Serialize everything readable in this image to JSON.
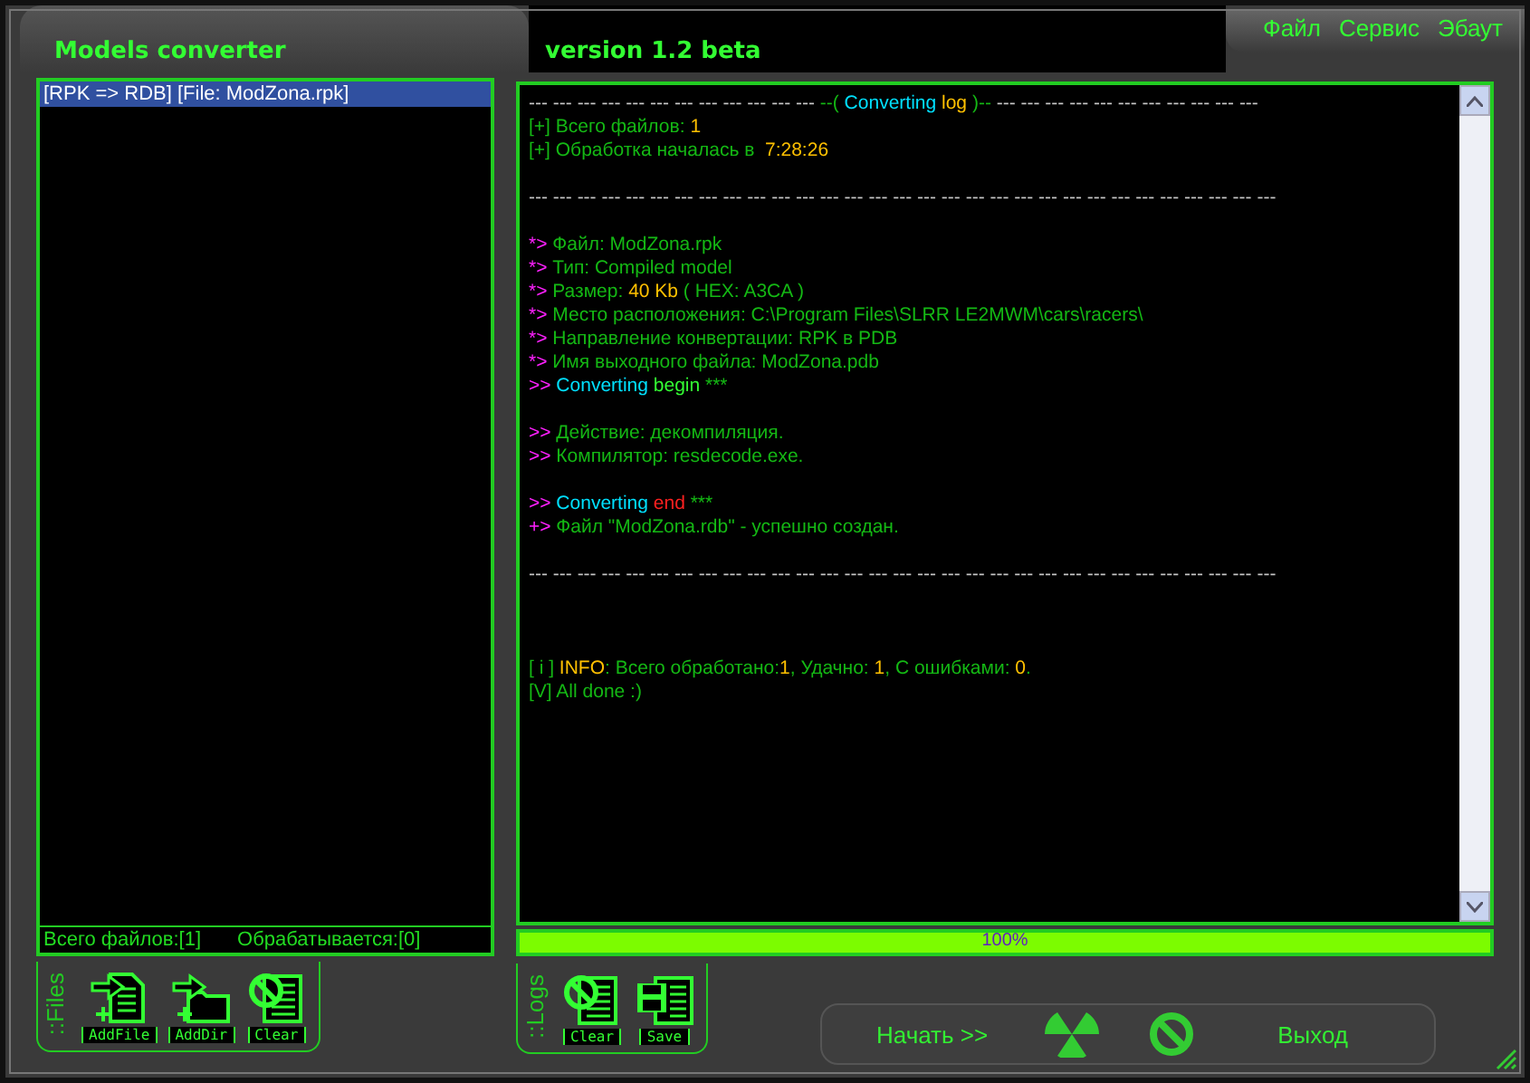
{
  "window": {
    "title": "Models converter",
    "version": "version 1.2 beta"
  },
  "menu": [
    {
      "label": "Файл"
    },
    {
      "label": "Сервис"
    },
    {
      "label": "Эбаут"
    }
  ],
  "files": {
    "items": [
      {
        "label": "[RPK => RDB] [File: ModZona.rpk]",
        "selected": true
      }
    ],
    "status": [
      "Всего файлов:[1]",
      "Обрабатывается:[0]"
    ],
    "toolbar_label": "::Files",
    "tools": [
      {
        "kind": "add_file",
        "label": "AddFile"
      },
      {
        "kind": "add_dir",
        "label": "AddDir"
      },
      {
        "kind": "clear",
        "label": "Clear"
      }
    ]
  },
  "log": {
    "lines": [
      {
        "kind": "text",
        "segments": [
          {
            "kind": "rule",
            "text": "--- --- --- --- --- --- --- --- --- --- --- --- "
          },
          {
            "kind": "text",
            "text": "--("
          },
          {
            "kind": "accent",
            "text": " Converting"
          },
          {
            "kind": "value",
            "text": " log"
          },
          {
            "kind": "text",
            "text": " )--"
          },
          {
            "kind": "rule",
            "text": " --- --- --- --- --- --- --- --- --- --- ---"
          }
        ]
      },
      {
        "kind": "text",
        "segments": [
          {
            "kind": "text",
            "text": "[+] Всего файлов: "
          },
          {
            "kind": "value",
            "text": "1"
          }
        ]
      },
      {
        "kind": "text",
        "segments": [
          {
            "kind": "text",
            "text": "[+] Обработка началась в  "
          },
          {
            "kind": "value",
            "text": "7:28:26"
          }
        ]
      },
      {
        "kind": "blank"
      },
      {
        "kind": "text",
        "segments": [
          {
            "kind": "rule",
            "text": "--- --- --- --- --- --- --- --- --- --- --- --- --- --- --- --- --- --- --- --- --- --- --- --- --- --- --- --- --- --- ---"
          }
        ]
      },
      {
        "kind": "blank"
      },
      {
        "kind": "text",
        "segments": [
          {
            "kind": "mark",
            "text": "*>"
          },
          {
            "kind": "text",
            "text": " Файл: ModZona.rpk"
          }
        ]
      },
      {
        "kind": "text",
        "segments": [
          {
            "kind": "mark",
            "text": "*>"
          },
          {
            "kind": "text",
            "text": " Тип: Compiled model"
          }
        ]
      },
      {
        "kind": "text",
        "segments": [
          {
            "kind": "mark",
            "text": "*>"
          },
          {
            "kind": "text",
            "text": " Размер: "
          },
          {
            "kind": "value",
            "text": "40 Kb"
          },
          {
            "kind": "text",
            "text": " ( HEX: A3CA )"
          }
        ]
      },
      {
        "kind": "text",
        "segments": [
          {
            "kind": "mark",
            "text": "*>"
          },
          {
            "kind": "text",
            "text": " Место расположения: C:\\Program Files\\SLRR LE2MWM\\cars\\racers\\"
          }
        ]
      },
      {
        "kind": "text",
        "segments": [
          {
            "kind": "mark",
            "text": "*>"
          },
          {
            "kind": "text",
            "text": " Направление конвертации: RPK в PDB"
          }
        ]
      },
      {
        "kind": "text",
        "segments": [
          {
            "kind": "mark",
            "text": "*>"
          },
          {
            "kind": "text",
            "text": " Имя выходного файла: ModZona.pdb"
          }
        ]
      },
      {
        "kind": "text",
        "segments": [
          {
            "kind": "mark",
            "text": ">>"
          },
          {
            "kind": "accent",
            "text": " Converting"
          },
          {
            "kind": "good",
            "text": " begin"
          },
          {
            "kind": "text",
            "text": " ***"
          }
        ]
      },
      {
        "kind": "blank"
      },
      {
        "kind": "text",
        "segments": [
          {
            "kind": "mark",
            "text": ">>"
          },
          {
            "kind": "text",
            "text": " Действие: декомпиляция."
          }
        ]
      },
      {
        "kind": "text",
        "segments": [
          {
            "kind": "mark",
            "text": ">>"
          },
          {
            "kind": "text",
            "text": " Компилятор: resdecode.exe."
          }
        ]
      },
      {
        "kind": "blank"
      },
      {
        "kind": "text",
        "segments": [
          {
            "kind": "mark",
            "text": ">>"
          },
          {
            "kind": "accent",
            "text": " Converting"
          },
          {
            "kind": "error",
            "text": " end"
          },
          {
            "kind": "text",
            "text": " ***"
          }
        ]
      },
      {
        "kind": "text",
        "segments": [
          {
            "kind": "mark",
            "text": "+>"
          },
          {
            "kind": "text",
            "text": " Файл \"ModZona.rdb\" - успешно создан."
          }
        ]
      },
      {
        "kind": "blank"
      },
      {
        "kind": "text",
        "segments": [
          {
            "kind": "rule",
            "text": "--- --- --- --- --- --- --- --- --- --- --- --- --- --- --- --- --- --- --- --- --- --- --- --- --- --- --- --- --- --- ---"
          }
        ]
      },
      {
        "kind": "blank"
      },
      {
        "kind": "blank"
      },
      {
        "kind": "blank"
      },
      {
        "kind": "text",
        "segments": [
          {
            "kind": "text",
            "text": "[ i ] "
          },
          {
            "kind": "value",
            "text": "INFO"
          },
          {
            "kind": "text",
            "text": ": Всего обработано:"
          },
          {
            "kind": "value",
            "text": "1"
          },
          {
            "kind": "text",
            "text": ", Удачно: "
          },
          {
            "kind": "value",
            "text": "1"
          },
          {
            "kind": "text",
            "text": ", С ошибками: "
          },
          {
            "kind": "value",
            "text": "0"
          },
          {
            "kind": "text",
            "text": "."
          }
        ]
      },
      {
        "kind": "text",
        "segments": [
          {
            "kind": "text",
            "text": "[V] All done :)"
          }
        ]
      }
    ]
  },
  "progress": {
    "level": 1,
    "reading": "100%"
  },
  "log_tools": {
    "toolbar_label": "::Logs",
    "tools": [
      {
        "kind": "clear",
        "label": "Clear"
      },
      {
        "kind": "save",
        "label": "Save"
      }
    ]
  },
  "actions": {
    "start": "Начать >>",
    "exit": "Выход"
  }
}
